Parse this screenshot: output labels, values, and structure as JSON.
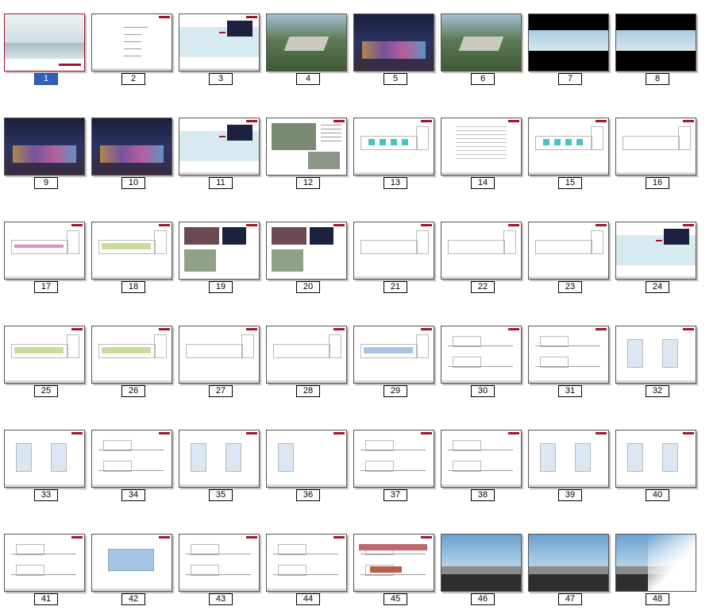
{
  "slides": [
    {
      "n": "1",
      "kind": "cover",
      "selected": true
    },
    {
      "n": "2",
      "kind": "toc"
    },
    {
      "n": "3",
      "kind": "section"
    },
    {
      "n": "4",
      "kind": "aerial-day"
    },
    {
      "n": "5",
      "kind": "night-render"
    },
    {
      "n": "6",
      "kind": "aerial-day"
    },
    {
      "n": "7",
      "kind": "panorama"
    },
    {
      "n": "8",
      "kind": "panorama"
    },
    {
      "n": "9",
      "kind": "night-render"
    },
    {
      "n": "10",
      "kind": "night-render"
    },
    {
      "n": "11",
      "kind": "section"
    },
    {
      "n": "12",
      "kind": "site-photo"
    },
    {
      "n": "13",
      "kind": "plan-color"
    },
    {
      "n": "14",
      "kind": "table"
    },
    {
      "n": "15",
      "kind": "plan-color"
    },
    {
      "n": "16",
      "kind": "plan"
    },
    {
      "n": "17",
      "kind": "plan-pink"
    },
    {
      "n": "18",
      "kind": "plan-green"
    },
    {
      "n": "19",
      "kind": "collage"
    },
    {
      "n": "20",
      "kind": "collage"
    },
    {
      "n": "21",
      "kind": "plan"
    },
    {
      "n": "22",
      "kind": "plan"
    },
    {
      "n": "23",
      "kind": "plan"
    },
    {
      "n": "24",
      "kind": "section"
    },
    {
      "n": "25",
      "kind": "plan-green"
    },
    {
      "n": "26",
      "kind": "plan-green"
    },
    {
      "n": "27",
      "kind": "plan"
    },
    {
      "n": "28",
      "kind": "plan-blank"
    },
    {
      "n": "29",
      "kind": "plan-blue"
    },
    {
      "n": "30",
      "kind": "elevation"
    },
    {
      "n": "31",
      "kind": "elevation"
    },
    {
      "n": "32",
      "kind": "floor-plan"
    },
    {
      "n": "33",
      "kind": "floor-plan"
    },
    {
      "n": "34",
      "kind": "elevation"
    },
    {
      "n": "35",
      "kind": "floor-plan"
    },
    {
      "n": "36",
      "kind": "floor-plan-single"
    },
    {
      "n": "37",
      "kind": "elevation"
    },
    {
      "n": "38",
      "kind": "elevation"
    },
    {
      "n": "39",
      "kind": "floor-plan"
    },
    {
      "n": "40",
      "kind": "floor-plan"
    },
    {
      "n": "41",
      "kind": "elevation"
    },
    {
      "n": "42",
      "kind": "floor-blue"
    },
    {
      "n": "43",
      "kind": "elevation"
    },
    {
      "n": "44",
      "kind": "elevation"
    },
    {
      "n": "45",
      "kind": "colored-elevation"
    },
    {
      "n": "46",
      "kind": "street-render"
    },
    {
      "n": "47",
      "kind": "street-render"
    },
    {
      "n": "48",
      "kind": "street-render-partial"
    }
  ],
  "colors": {
    "selected_label": "#2f62b7",
    "accent_red": "#a3152b",
    "section_band": "#d7eaf0",
    "night": "#1d2140",
    "sky": "#9fc8e0"
  }
}
